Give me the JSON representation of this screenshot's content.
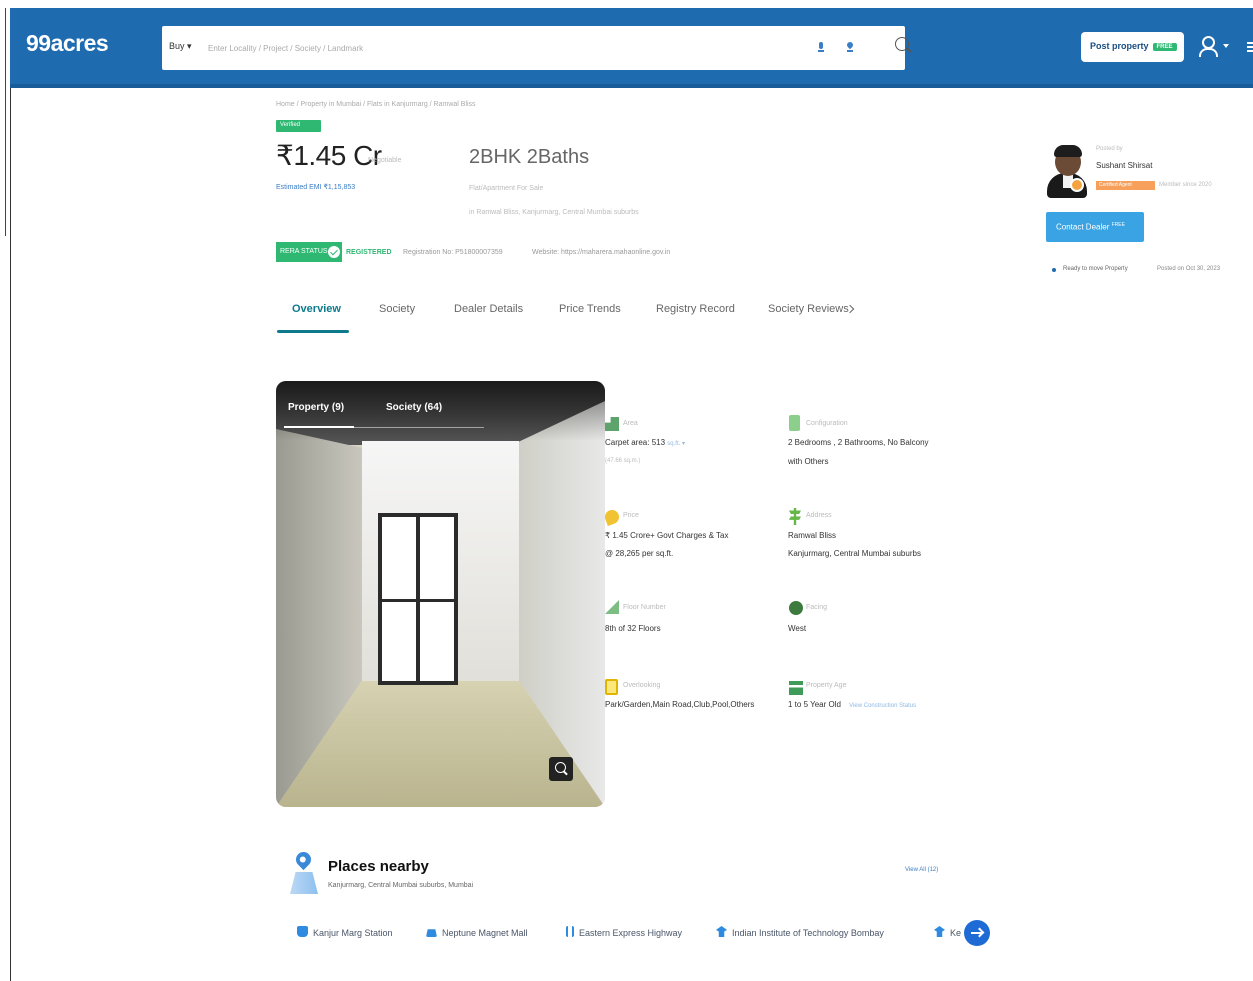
{
  "nav": {
    "logo": "99acres",
    "buy_label": "Buy ▾",
    "search_placeholder": "Enter Locality / Project / Society / Landmark",
    "post_property_label": "Post property",
    "free_badge": "FREE"
  },
  "header": {
    "breadcrumb": "Home / Property in Mumbai / Flats in Kanjurmarg / Ramwal Bliss",
    "verified_badge": "Verified",
    "price": "₹1.45 Cr",
    "price_note": "Negotiable",
    "emi": "Estimated EMI ₹1,15,853",
    "bhk": "2BHK 2Baths",
    "bhk_sub1": "Flat/Apartment For Sale",
    "bhk_sub2": "in Ramwal Bliss, Kanjurmarg, Central Mumbai suburbs",
    "rera_label": "RERA STATUS",
    "rera_status": "REGISTERED",
    "rera_reg_no": "Registration No: P51800007359",
    "rera_website": "Website: https://maharera.mahaonline.gov.in"
  },
  "dealer": {
    "label": "Posted by",
    "name": "Sushant Shirsat",
    "tag": "Certified Agent",
    "since": "Member since 2020",
    "contact_label": "Contact Dealer",
    "contact_badge": "FREE",
    "ready_text": "Ready to move Property",
    "posted_text": "Posted on Oct 30, 2023"
  },
  "tabs": [
    "Overview",
    "Society",
    "Dealer Details",
    "Price Trends",
    "Registry Record",
    "Society Reviews"
  ],
  "photo": {
    "tab_property": "Property (9)",
    "tab_society": "Society (64)"
  },
  "details": {
    "area_label": "Area",
    "area_value": "Carpet area: 513",
    "area_unit": "sq.ft. ▾",
    "area_sub": "(47.66 sq.m.)",
    "config_label": "Configuration",
    "config_value1": "2 Bedrooms , 2 Bathrooms, No Balcony",
    "config_value2": "with Others",
    "price_label": "Price",
    "price_value1": "₹ 1.45 Crore+ Govt Charges & Tax",
    "price_value2": "@ 28,265 per sq.ft.",
    "address_label": "Address",
    "address_value1": "Ramwal Bliss",
    "address_value2": "Kanjurmarg, Central Mumbai suburbs",
    "floor_label": "Floor Number",
    "floor_value": "8th of 32 Floors",
    "facing_label": "Facing",
    "facing_value": "West",
    "overlooking_label": "Overlooking",
    "overlooking_value": "Park/Garden,Main Road,Club,Pool,Others",
    "age_label": "Property Age",
    "age_value": "1 to 5 Year Old",
    "age_link": "View Construction Status"
  },
  "places": {
    "title": "Places nearby",
    "subtitle": "Kanjurmarg, Central Mumbai suburbs, Mumbai",
    "view_all": "View All (12)",
    "items": [
      "Kanjur Marg Station",
      "Neptune Magnet Mall",
      "Eastern Express Highway",
      "Indian Institute of Technology Bombay",
      "Ke"
    ]
  },
  "colors": {
    "brand_blue": "#1e6bb0",
    "accent_teal": "#0e7a8c",
    "green": "#2eb872",
    "contact_blue": "#3aa3e3"
  }
}
